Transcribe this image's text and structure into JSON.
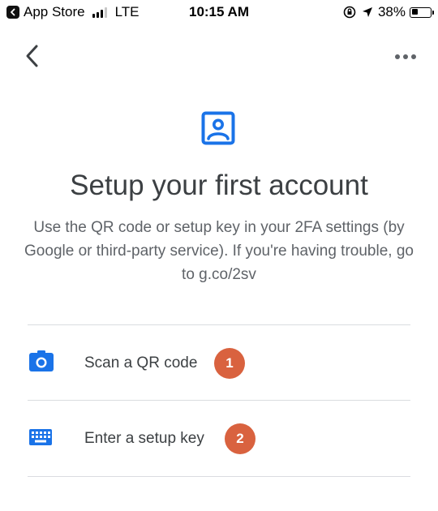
{
  "status_bar": {
    "back_app": "App Store",
    "carrier": "LTE",
    "time": "10:15 AM",
    "battery": "38%",
    "battery_level": 0.38
  },
  "header": {
    "title": "Setup your first account",
    "description": "Use the QR code or setup key in your 2FA settings (by Google or third-party service). If you're having trouble, go to g.co/2sv"
  },
  "options": [
    {
      "label": "Scan a QR code",
      "icon": "camera-icon",
      "badge": "1"
    },
    {
      "label": "Enter a setup key",
      "icon": "keyboard-icon",
      "badge": "2"
    }
  ],
  "colors": {
    "accent_blue": "#1a73e8",
    "badge_orange": "#d9623f"
  }
}
